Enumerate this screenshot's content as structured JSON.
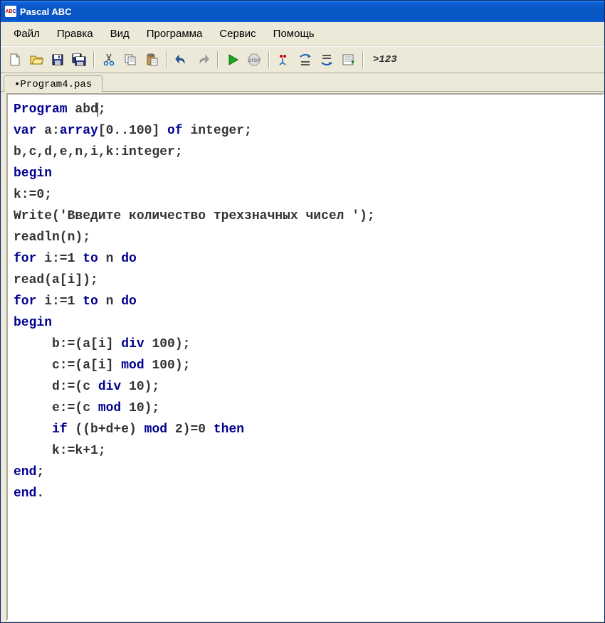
{
  "titlebar": {
    "title": "Pascal ABC"
  },
  "menu": {
    "file": "Файл",
    "edit": "Правка",
    "view": "Вид",
    "program": "Программа",
    "service": "Сервис",
    "help": "Помощь"
  },
  "toolbar": {
    "goto_label": ">123"
  },
  "tabs": {
    "active": "•Program4.pas"
  },
  "code": {
    "l1_kw": "Program",
    "l1_txt": " abd",
    "l1_end": ";",
    "l2_kw1": "var",
    "l2_txt1": " a:",
    "l2_kw2": "array",
    "l2_txt2": "[0..100] ",
    "l2_kw3": "of",
    "l2_txt3": " integer;",
    "l3": "b,c,d,e,n,i,k:integer;",
    "l4_kw": "begin",
    "l5": "k:=0;",
    "l6": "Write('Введите количество трехзначных чисел ');",
    "l7": "readln(n);",
    "l8_kw1": "for",
    "l8_txt1": " i:=1 ",
    "l8_kw2": "to",
    "l8_txt2": " n ",
    "l8_kw3": "do",
    "l9": "read(a[i]);",
    "l10_kw1": "for",
    "l10_txt1": " i:=1 ",
    "l10_kw2": "to",
    "l10_txt2": " n ",
    "l10_kw3": "do",
    "l11_kw": "begin",
    "l12_pre": "     b:=(a[i] ",
    "l12_kw": "div",
    "l12_post": " 100);",
    "l13_pre": "     c:=(a[i] ",
    "l13_kw": "mod",
    "l13_post": " 100);",
    "l14_pre": "     d:=(c ",
    "l14_kw": "div",
    "l14_post": " 10);",
    "l15_pre": "     e:=(c ",
    "l15_kw": "mod",
    "l15_post": " 10);",
    "l16_pre": "     ",
    "l16_kw1": "if",
    "l16_mid": " ((b+d+e) ",
    "l16_kw2": "mod",
    "l16_mid2": " 2)=0 ",
    "l16_kw3": "then",
    "l17": "     k:=k+1;",
    "l18_kw": "end",
    "l18_txt": ";",
    "l19_kw": "end",
    "l19_txt": "."
  }
}
